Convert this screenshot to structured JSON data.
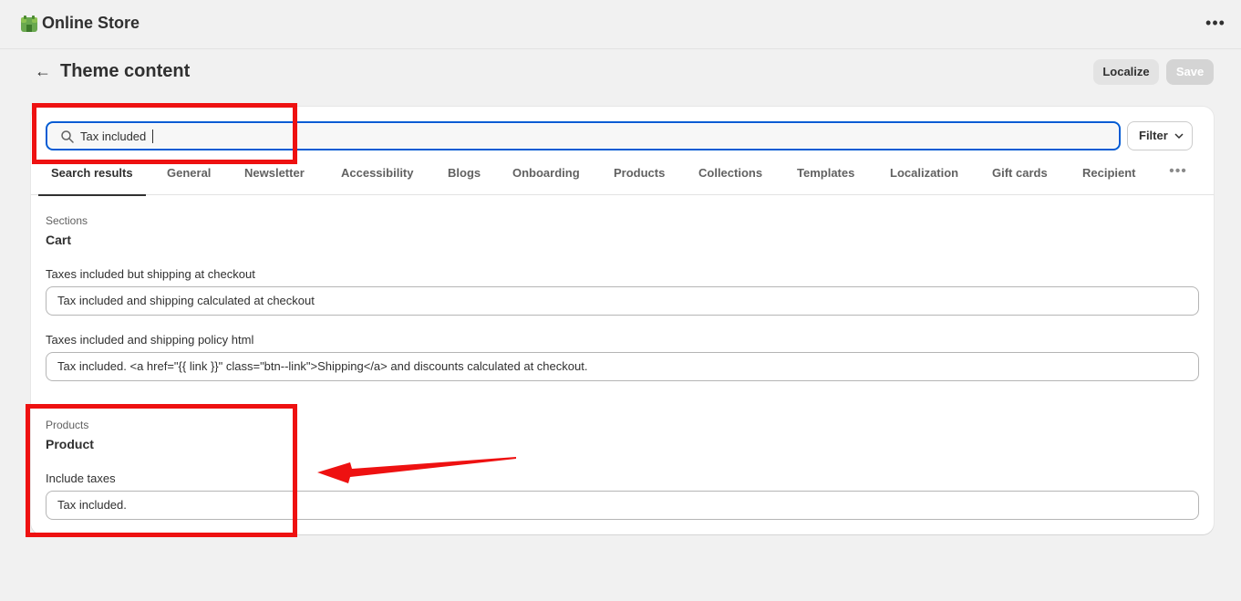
{
  "app": {
    "title": "Online Store",
    "logo_icon": "shopify-store-icon",
    "more_icon": "more-horizontal-icon"
  },
  "page": {
    "back_icon": "arrow-left-icon",
    "title": "Theme content",
    "localize_label": "Localize",
    "save_label": "Save"
  },
  "search": {
    "value": "Tax included",
    "icon": "search-icon",
    "filter_label": "Filter",
    "filter_icon": "chevron-down-icon"
  },
  "tabs": [
    {
      "label": "Search results",
      "active": true
    },
    {
      "label": "General"
    },
    {
      "label": "Newsletter"
    },
    {
      "label": "Accessibility"
    },
    {
      "label": "Blogs"
    },
    {
      "label": "Onboarding"
    },
    {
      "label": "Products"
    },
    {
      "label": "Collections"
    },
    {
      "label": "Templates"
    },
    {
      "label": "Localization"
    },
    {
      "label": "Gift cards"
    },
    {
      "label": "Recipient"
    }
  ],
  "tabs_more_icon": "more-horizontal-icon",
  "groups": [
    {
      "label": "Sections",
      "title": "Cart",
      "fields": [
        {
          "label": "Taxes included but shipping at checkout",
          "value": "Tax included and shipping calculated at checkout"
        },
        {
          "label": "Taxes included and shipping policy html",
          "value": "Tax included. <a href=\"{{ link }}\" class=\"btn--link\">Shipping</a> and discounts calculated at checkout."
        }
      ]
    },
    {
      "label": "Products",
      "title": "Product",
      "fields": [
        {
          "label": "Include taxes",
          "value": "Tax included."
        }
      ]
    }
  ],
  "colors": {
    "highlight": "#ee1111",
    "focus": "#005bd3",
    "background": "#f1f1f1"
  }
}
